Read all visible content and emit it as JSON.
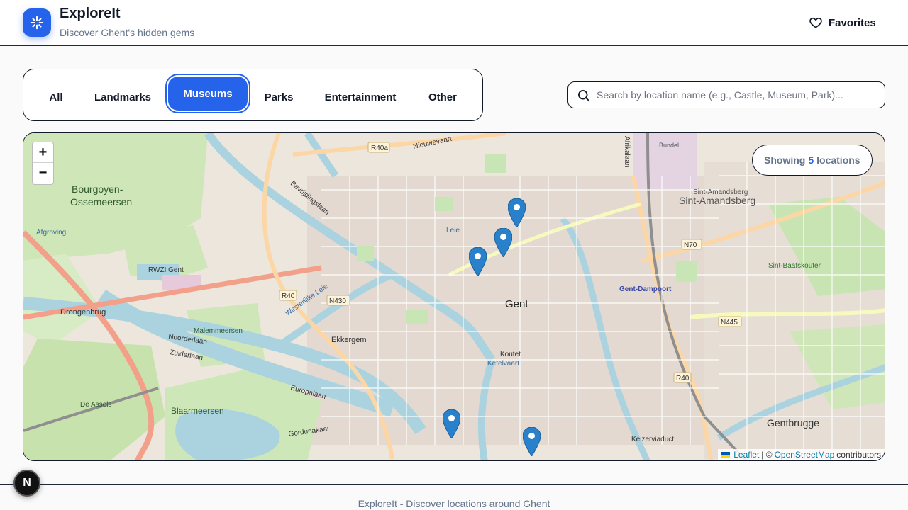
{
  "app": {
    "title": "ExploreIt",
    "subtitle": "Discover Ghent's hidden gems",
    "brand_color": "#2563eb"
  },
  "header": {
    "favorites_label": "Favorites",
    "favorites_icon": "heart-icon"
  },
  "filters": {
    "active": "Museums",
    "items": [
      {
        "label": "All"
      },
      {
        "label": "Landmarks"
      },
      {
        "label": "Museums"
      },
      {
        "label": "Parks"
      },
      {
        "label": "Entertainment"
      },
      {
        "label": "Other"
      }
    ]
  },
  "search": {
    "placeholder": "Search by location name (e.g., Castle, Museum, Park)...",
    "value": ""
  },
  "map": {
    "counter_prefix": "Showing",
    "counter_count": "5",
    "counter_suffix": "locations",
    "zoom_in": "+",
    "zoom_out": "−",
    "attribution": {
      "leaflet": "Leaflet",
      "separator": "| ©",
      "osm": "OpenStreetMap",
      "suffix": "contributors"
    },
    "labels": {
      "gent": "Gent",
      "bourgoyen": "Bourgoyen-",
      "ossemeersen": "Ossemeersen",
      "sint_amandsberg_small": "Sint-Amandsberg",
      "sint_amandsberg": "Sint-Amandsberg",
      "gentbrugge": "Gentbrugge",
      "ekkergem": "Ekkergem",
      "drongenbrug": "Drongenbrug",
      "rwzi": "RWZI Gent",
      "malemmeersen": "Malemmeersen",
      "blaarmeersen": "Blaarmeersen",
      "de_assels": "De Assels",
      "gent_dampoort": "Gent-Dampoort",
      "sint_baafskouter": "Sint-Baafskouter",
      "afgroving": "Afgroving",
      "noorderlaan": "Noorderlaan",
      "zuiderlaan": "Zuiderlaan",
      "europalaan": "Europalaan",
      "gordunakaai": "Gordunakaai",
      "keizerviaduct": "Keizerviaduct",
      "koutet": "Koutet",
      "ketelvaart": "Ketelvaart",
      "bevrijdingslaan": "Bevrijdingslaan",
      "nieuwevaart": "Nieuwevaart",
      "afrikalaan": "Afrikalaan",
      "westerlijke_leie": "Westerlijke Leie",
      "leie": "Leie",
      "r40a": "R40a",
      "r40": "R40",
      "n430": "N430",
      "n70": "N70",
      "n445": "N445",
      "r40b": "R40",
      "bundel": "Bundel"
    },
    "marker_color": "#2a81cb"
  },
  "footer": {
    "text": "ExploreIt - Discover locations around Ghent"
  },
  "devtools": {
    "badge": "N"
  }
}
